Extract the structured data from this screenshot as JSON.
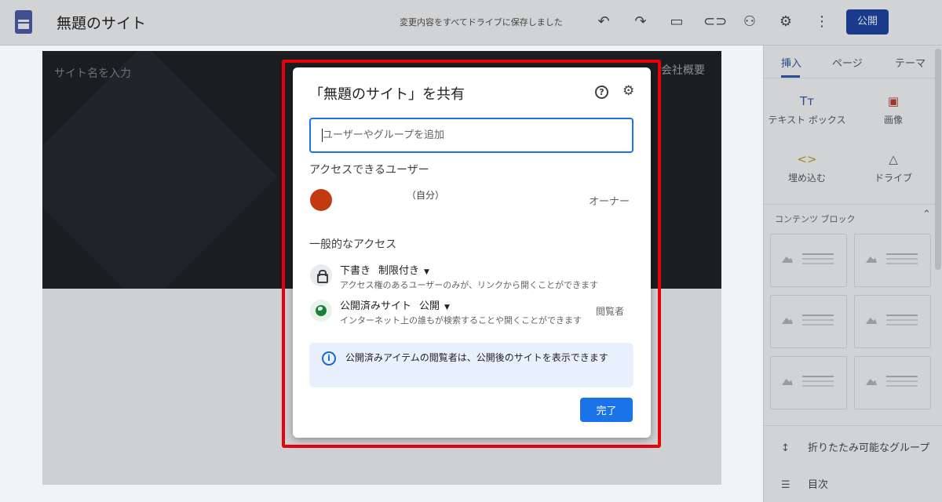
{
  "header": {
    "site_title": "無題のサイト",
    "save_status": "変更内容をすべてドライブに保存しました",
    "publish_label": "公開"
  },
  "canvas": {
    "site_name_placeholder": "サイト名を入力",
    "nav_item": "会社概要"
  },
  "right_panel": {
    "tabs": [
      {
        "label": "挿入",
        "active": true
      },
      {
        "label": "ページ",
        "active": false
      },
      {
        "label": "テーマ",
        "active": false
      }
    ],
    "insert_items": [
      {
        "label": "テキスト ボックス",
        "icon": "text-box-icon"
      },
      {
        "label": "画像",
        "icon": "image-icon"
      },
      {
        "label": "埋め込む",
        "icon": "embed-icon"
      },
      {
        "label": "ドライブ",
        "icon": "drive-icon"
      }
    ],
    "content_blocks_label": "コンテンツ ブロック",
    "list_items": [
      {
        "label": "折りたたみ可能なグループ",
        "icon": "collapsible-group-icon"
      },
      {
        "label": "目次",
        "icon": "table-of-contents-icon"
      }
    ]
  },
  "dialog": {
    "title": "「無題のサイト」を共有",
    "input_placeholder": "ユーザーやグループを追加",
    "users_heading": "アクセスできるユーザー",
    "self_label": "（自分）",
    "owner_label": "オーナー",
    "general_heading": "一般的なアクセス",
    "draft": {
      "title": "下書き",
      "setting": "制限付き",
      "description": "アクセス権のあるユーザーのみが、リンクから開くことができます"
    },
    "published": {
      "title": "公開済みサイト",
      "setting": "公開",
      "description": "インターネット上の誰もが検索することや開くことができます",
      "role": "閲覧者"
    },
    "info_text": "公開済みアイテムの閲覧者は、公開後のサイトを表示できます",
    "done_label": "完了"
  },
  "colors": {
    "accent_blue": "#1a73e8",
    "highlight_red": "#e8000b",
    "avatar": "#c23b10"
  }
}
